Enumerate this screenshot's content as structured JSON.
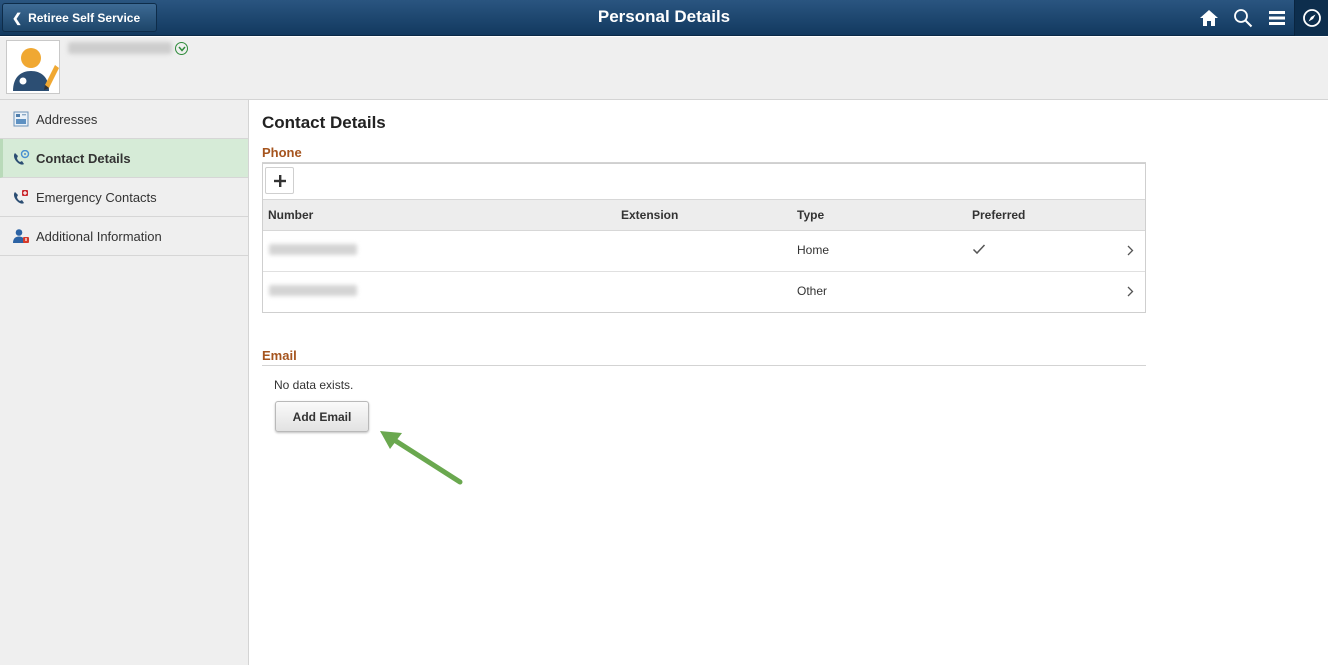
{
  "banner": {
    "back_label": "Retiree Self Service",
    "title": "Personal Details",
    "icons": [
      "home-icon",
      "search-icon",
      "menu-icon",
      "navbar-compass-icon"
    ]
  },
  "colors": {
    "banner": "#1e4670",
    "active_nav": "#d6ebd7",
    "section_title": "#a5541e",
    "arrow": "#6aa84f"
  },
  "sidebar": {
    "items": [
      {
        "label": "Addresses",
        "icon": "address-book-icon",
        "active": false
      },
      {
        "label": "Contact Details",
        "icon": "phone-icon",
        "active": true
      },
      {
        "label": "Emergency Contacts",
        "icon": "emergency-phone-icon",
        "active": false
      },
      {
        "label": "Additional Information",
        "icon": "person-info-icon",
        "active": false
      }
    ]
  },
  "main": {
    "page_title": "Contact Details",
    "phone": {
      "section_title": "Phone",
      "columns": [
        "Number",
        "Extension",
        "Type",
        "Preferred"
      ],
      "rows": [
        {
          "type": "Home",
          "preferred": true
        },
        {
          "type": "Other",
          "preferred": false
        }
      ]
    },
    "email": {
      "section_title": "Email",
      "empty_message": "No data exists.",
      "add_button": "Add Email"
    }
  }
}
